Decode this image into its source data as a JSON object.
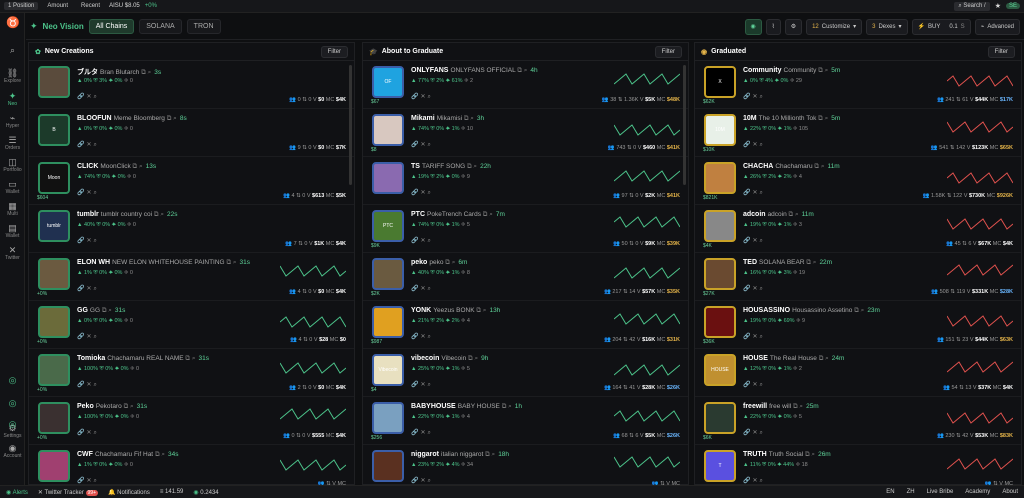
{
  "topbar": {
    "position": "1 Position",
    "amount": "Amount",
    "recent": "Recent",
    "ticker": "AISU $8.05",
    "ticker_change": "+0%",
    "search": "Search",
    "search_key": "/",
    "user": "SE"
  },
  "sidebar": [
    {
      "icon": "⌕",
      "label": ""
    },
    {
      "icon": "⛓",
      "label": "Explore"
    },
    {
      "icon": "✦",
      "label": "Neo",
      "active": true
    },
    {
      "icon": "⌁",
      "label": "Hyper"
    },
    {
      "icon": "☰",
      "label": "Orders"
    },
    {
      "icon": "◫",
      "label": "Portfolio"
    },
    {
      "icon": "▭",
      "label": "Wallet"
    },
    {
      "icon": "▦",
      "label": "Multi"
    },
    {
      "icon": "▤",
      "label": "Wallet"
    },
    {
      "icon": "✕",
      "label": "Twitter"
    },
    {
      "icon": "⚙",
      "label": "Settings"
    },
    {
      "icon": "◉",
      "label": "Account"
    }
  ],
  "subbar": {
    "title": "Neo Vision",
    "chains": [
      "All Chains",
      "SOLANA",
      "TRON"
    ],
    "customize": "Customize",
    "customize_n": "12",
    "dexes": "Dexes",
    "dexes_n": "3",
    "buy": "BUY",
    "buy_amt": "0.1",
    "buy_unit": "S",
    "advanced": "Advanced"
  },
  "columns": [
    {
      "title": "New Creations",
      "filter": "Filter",
      "rows": [
        {
          "sym": "ブルタ",
          "name": "Bran Blutarch",
          "age": "3s",
          "s1": "0%",
          "s2": "3%",
          "s3": "0%",
          "s4": "0",
          "label": "",
          "h": "0",
          "t": "0",
          "v": "$0",
          "mc": "$4K",
          "thumb": "",
          "tc": "#5a4b3c"
        },
        {
          "sym": "BLOOFUN",
          "name": "Meme Bloomberg",
          "age": "8s",
          "s1": "0%",
          "s2": "0%",
          "s3": "0%",
          "s4": "0",
          "label": "",
          "h": "9",
          "t": "0",
          "v": "$0",
          "mc": "$7K",
          "thumb": "B",
          "tc": "#1c3a2a"
        },
        {
          "sym": "CLICK",
          "name": "MoonClick",
          "age": "13s",
          "s1": "74%",
          "s2": "0%",
          "s3": "0%",
          "s4": "0",
          "label": "$604",
          "h": "4",
          "t": "0",
          "v": "$613",
          "mc": "$5K",
          "thumb": "Moon",
          "tc": "#111"
        },
        {
          "sym": "tumblr",
          "name": "tumblr country coi",
          "age": "22s",
          "s1": "40%",
          "s2": "0%",
          "s3": "0%",
          "s4": "0",
          "label": "",
          "h": "7",
          "t": "0",
          "v": "$1K",
          "mc": "$4K",
          "thumb": "tumblr",
          "tc": "#203050"
        },
        {
          "sym": "ELON WH",
          "name": "NEW ELON WHITEHOUSE PAINTING",
          "age": "31s",
          "s1": "1%",
          "s2": "0%",
          "s3": "0%",
          "s4": "0",
          "label": "+0%",
          "h": "4",
          "t": "0",
          "v": "$0",
          "mc": "$4K",
          "thumb": "",
          "tc": "#6b5a40"
        },
        {
          "sym": "GG",
          "name": "GG",
          "age": "31s",
          "s1": "0%",
          "s2": "0%",
          "s3": "0%",
          "s4": "0",
          "label": "+0%",
          "h": "4",
          "t": "0",
          "v": "$28",
          "mc": "$0",
          "thumb": "",
          "tc": "#6b6b3a"
        },
        {
          "sym": "Tomioka",
          "name": "Chachamaru REAL NAME",
          "age": "31s",
          "s1": "100%",
          "s2": "0%",
          "s3": "0%",
          "s4": "0",
          "label": "+0%",
          "h": "2",
          "t": "0",
          "v": "$0",
          "mc": "$4K",
          "thumb": "",
          "tc": "#4a6a4a"
        },
        {
          "sym": "Peko",
          "name": "Pekotaro",
          "age": "31s",
          "s1": "100%",
          "s2": "0%",
          "s3": "0%",
          "s4": "0",
          "label": "+0%",
          "h": "0",
          "t": "0",
          "v": "$555",
          "mc": "$4K",
          "thumb": "",
          "tc": "#3a3030"
        },
        {
          "sym": "CWF",
          "name": "Chachamaru Fif Hat",
          "age": "34s",
          "s1": "1%",
          "s2": "0%",
          "s3": "0%",
          "s4": "0",
          "label": "",
          "h": "",
          "t": "",
          "v": "",
          "mc": "",
          "thumb": "",
          "tc": "#a04070"
        }
      ]
    },
    {
      "title": "About to Graduate",
      "filter": "Filter",
      "rows": [
        {
          "sym": "ONLYFANS",
          "name": "ONLYFANS OFFICIAL",
          "age": "4h",
          "s1": "77%",
          "s2": "2%",
          "s3": "61%",
          "s4": "2",
          "label": "$67",
          "h": "38",
          "t": "1.36K",
          "v": "$5K",
          "mc": "$48K",
          "mcc": "gold",
          "thumb": "OF",
          "tc": "#1fa3e0"
        },
        {
          "sym": "Mikami",
          "name": "Mikamisi",
          "age": "3h",
          "s1": "74%",
          "s2": "0%",
          "s3": "1%",
          "s4": "10",
          "label": "$8",
          "h": "743",
          "t": "0",
          "v": "$460",
          "mc": "$41K",
          "mcc": "gold",
          "thumb": "",
          "tc": "#d8c8c0"
        },
        {
          "sym": "TS",
          "name": "TARIFF SONG",
          "age": "22h",
          "s1": "19%",
          "s2": "2%",
          "s3": "0%",
          "s4": "9",
          "label": "",
          "h": "97",
          "t": "0",
          "v": "$2K",
          "mc": "$41K",
          "mcc": "gold",
          "thumb": "",
          "tc": "#8a6ab0"
        },
        {
          "sym": "PTC",
          "name": "PokeTrench Cards",
          "age": "7m",
          "s1": "74%",
          "s2": "0%",
          "s3": "1%",
          "s4": "5",
          "label": "$9K",
          "h": "50",
          "t": "0",
          "v": "$9K",
          "mc": "$39K",
          "mcc": "gold",
          "thumb": "PTC",
          "tc": "#4a7a30"
        },
        {
          "sym": "peko",
          "name": "peko",
          "age": "6m",
          "s1": "40%",
          "s2": "0%",
          "s3": "1%",
          "s4": "8",
          "label": "$2K",
          "h": "217",
          "t": "14",
          "v": "$57K",
          "mc": "$35K",
          "mcc": "gold",
          "thumb": "",
          "tc": "#6a5a40"
        },
        {
          "sym": "YONK",
          "name": "Yeezus BONK",
          "age": "13h",
          "s1": "21%",
          "s2": "2%",
          "s3": "2%",
          "s4": "4",
          "label": "$987",
          "h": "204",
          "t": "42",
          "v": "$16K",
          "mc": "$31K",
          "mcc": "gold",
          "thumb": "",
          "tc": "#e0a020"
        },
        {
          "sym": "vibecoin",
          "name": "Vibecoin",
          "age": "9h",
          "s1": "25%",
          "s2": "0%",
          "s3": "1%",
          "s4": "5",
          "label": "$4",
          "h": "164",
          "t": "41",
          "v": "$28K",
          "mc": "$26K",
          "mcc": "bl",
          "thumb": "Vibecoin",
          "tc": "#e8e0c0"
        },
        {
          "sym": "BABYHOUSE",
          "name": "BABY HOUSE",
          "age": "1h",
          "s1": "22%",
          "s2": "0%",
          "s3": "1%",
          "s4": "4",
          "label": "$256",
          "h": "68",
          "t": "6",
          "v": "$5K",
          "mc": "$26K",
          "mcc": "bl",
          "thumb": "",
          "tc": "#7aa0c0"
        },
        {
          "sym": "niggarot",
          "name": "italian niggarot",
          "age": "18h",
          "s1": "23%",
          "s2": "2%",
          "s3": "4%",
          "s4": "34",
          "label": "",
          "h": "",
          "t": "",
          "v": "",
          "mc": "",
          "mcc": "",
          "thumb": "",
          "tc": "#5a3020"
        }
      ]
    },
    {
      "title": "Graduated",
      "filter": "Filter",
      "rows": [
        {
          "sym": "Community",
          "name": "Community",
          "age": "5m",
          "s1": "0%",
          "s2": "4%",
          "s3": "0%",
          "s4": "29",
          "label": "$62K",
          "h": "241",
          "t": "61",
          "v": "$44K",
          "mc": "$17K",
          "mcc": "bl",
          "thumb": "X",
          "tc": "#000"
        },
        {
          "sym": "10M",
          "name": "The 10 Millionth Tok",
          "age": "5m",
          "s1": "22%",
          "s2": "0%",
          "s3": "1%",
          "s4": "105",
          "label": "$10K",
          "h": "541",
          "t": "142",
          "v": "$123K",
          "mc": "$65K",
          "mcc": "gold",
          "thumb": "10M",
          "tc": "#e8f0e8"
        },
        {
          "sym": "CHACHA",
          "name": "Chachamaru",
          "age": "11m",
          "s1": "26%",
          "s2": "2%",
          "s3": "2%",
          "s4": "4",
          "label": "$821K",
          "h": "1.58K",
          "t": "122",
          "v": "$730K",
          "mc": "$926K",
          "mcc": "gold",
          "thumb": "",
          "tc": "#c08040"
        },
        {
          "sym": "adcoin",
          "name": "adcoin",
          "age": "11m",
          "s1": "19%",
          "s2": "0%",
          "s3": "1%",
          "s4": "3",
          "label": "$4K",
          "h": "45",
          "t": "6",
          "v": "$67K",
          "mc": "$4K",
          "mcc": "",
          "thumb": "",
          "tc": "#888"
        },
        {
          "sym": "TED",
          "name": "SOLANA BEAR",
          "age": "22m",
          "s1": "16%",
          "s2": "0%",
          "s3": "3%",
          "s4": "19",
          "label": "$27K",
          "h": "508",
          "t": "119",
          "v": "$331K",
          "mc": "$28K",
          "mcc": "bl",
          "thumb": "",
          "tc": "#6a4a30"
        },
        {
          "sym": "HOUSASSINO",
          "name": "Housassino Assetino",
          "age": "23m",
          "s1": "19%",
          "s2": "0%",
          "s3": "69%",
          "s4": "9",
          "label": "$36K",
          "h": "151",
          "t": "23",
          "v": "$44K",
          "mc": "$63K",
          "mcc": "gold",
          "thumb": "",
          "tc": "#6a1010"
        },
        {
          "sym": "HOUSE",
          "name": "The Real House",
          "age": "24m",
          "s1": "12%",
          "s2": "0%",
          "s3": "1%",
          "s4": "2",
          "label": "",
          "h": "54",
          "t": "13",
          "v": "$37K",
          "mc": "$4K",
          "mcc": "",
          "thumb": "HOUSE",
          "tc": "#c09030"
        },
        {
          "sym": "freewill",
          "name": "free will",
          "age": "25m",
          "s1": "22%",
          "s2": "0%",
          "s3": "0%",
          "s4": "5",
          "label": "$6K",
          "h": "230",
          "t": "42",
          "v": "$53K",
          "mc": "$83K",
          "mcc": "gold",
          "thumb": "",
          "tc": "#2a3a30"
        },
        {
          "sym": "TRUTH",
          "name": "Truth Social",
          "age": "26m",
          "s1": "11%",
          "s2": "0%",
          "s3": "44%",
          "s4": "18",
          "label": "",
          "h": "",
          "t": "",
          "v": "",
          "mc": "",
          "mcc": "",
          "thumb": "T",
          "tc": "#5a50e0"
        }
      ]
    }
  ],
  "bottombar": {
    "alerts": "Alerts",
    "twitter": "Twitter Tracker",
    "twitter_badge": "99+",
    "notifications": "Notifications",
    "sol": "141.59",
    "eth": "0.2434",
    "lang": "EN",
    "lang2": "ZH",
    "live": "Live Bribe",
    "academy": "Academy",
    "about": "About"
  }
}
